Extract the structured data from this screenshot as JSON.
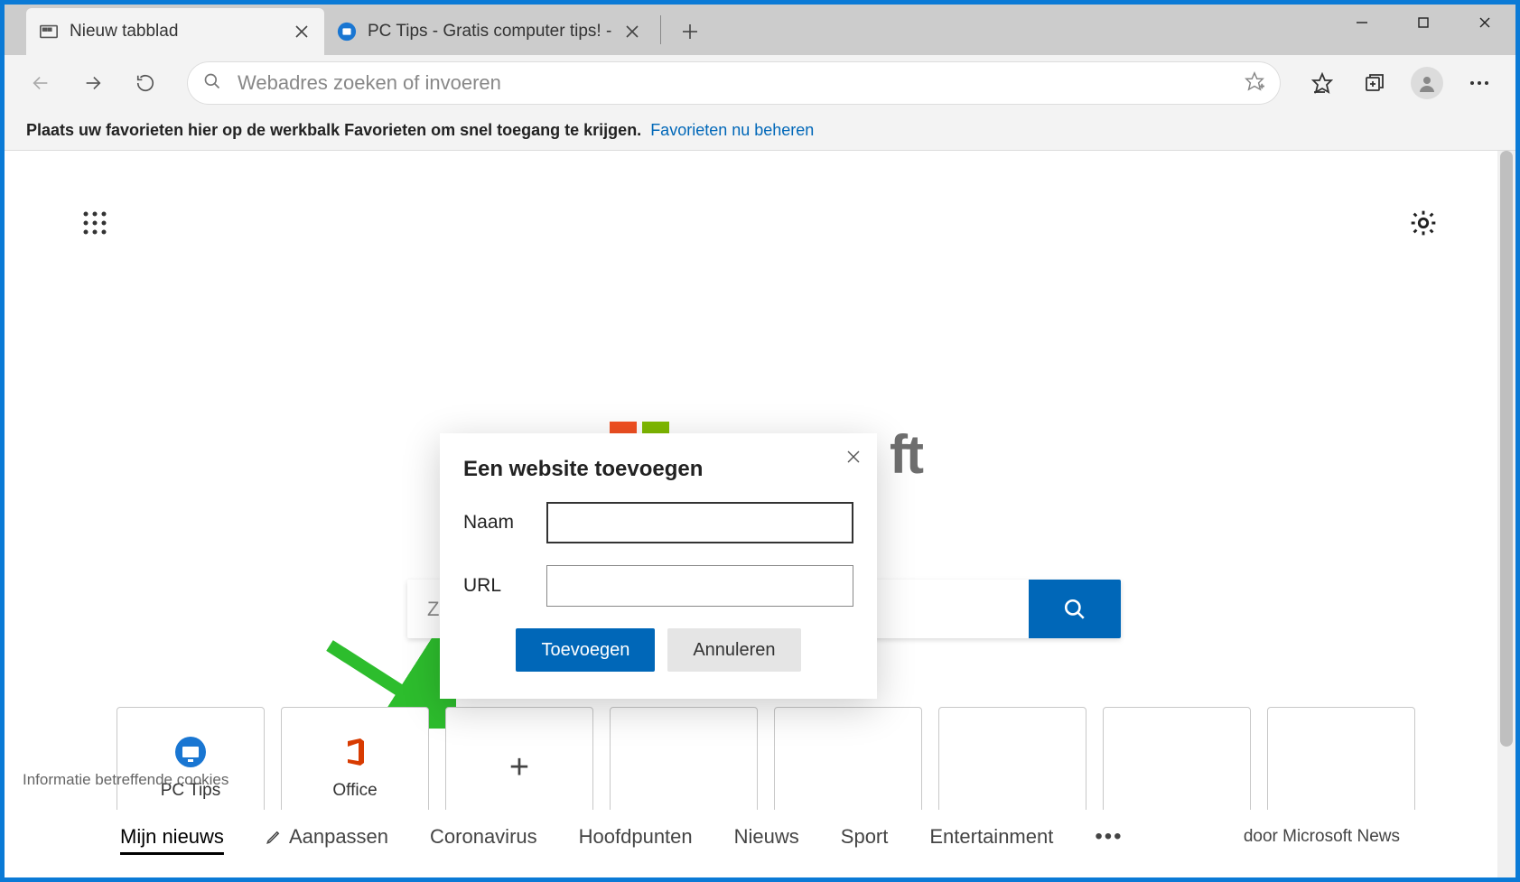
{
  "tabs": [
    {
      "title": "Nieuw tabblad",
      "active": true
    },
    {
      "title": "PC Tips - Gratis computer tips! -",
      "active": false
    }
  ],
  "addressbar": {
    "placeholder": "Webadres zoeken of invoeren"
  },
  "favbar": {
    "text": "Plaats uw favorieten hier op de werkbalk Favorieten om snel toegang te krijgen.",
    "link": "Favorieten nu beheren"
  },
  "logo_ft": "ft",
  "searchbox": {
    "placeholder_visible": "Zo"
  },
  "tiles": [
    {
      "label": "PC Tips",
      "type": "site"
    },
    {
      "label": "Office",
      "type": "office"
    },
    {
      "type": "add"
    },
    {
      "type": "empty"
    },
    {
      "type": "empty"
    },
    {
      "type": "empty"
    },
    {
      "type": "empty"
    },
    {
      "type": "empty"
    }
  ],
  "cookies": "Informatie betreffende cookies",
  "news": {
    "items": [
      "Mijn nieuws",
      "Aanpassen",
      "Coronavirus",
      "Hoofdpunten",
      "Nieuws",
      "Sport",
      "Entertainment"
    ],
    "active": 0,
    "attribution": "door Microsoft News"
  },
  "dialog": {
    "title": "Een website toevoegen",
    "name_label": "Naam",
    "url_label": "URL",
    "add_btn": "Toevoegen",
    "cancel_btn": "Annuleren"
  }
}
